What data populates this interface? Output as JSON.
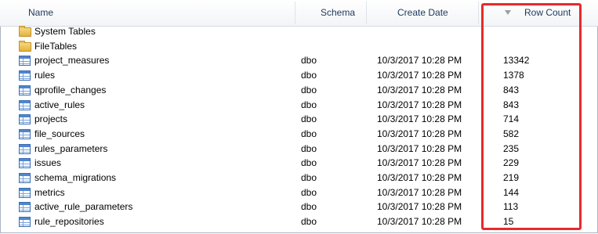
{
  "columns": {
    "name": "Name",
    "schema": "Schema",
    "create_date": "Create Date",
    "row_count": "Row Count"
  },
  "folders": [
    {
      "label": "System Tables"
    },
    {
      "label": "FileTables"
    }
  ],
  "tables": [
    {
      "name": "project_measures",
      "schema": "dbo",
      "create_date": "10/3/2017 10:28 PM",
      "row_count": "13342"
    },
    {
      "name": "rules",
      "schema": "dbo",
      "create_date": "10/3/2017 10:28 PM",
      "row_count": "1378"
    },
    {
      "name": "qprofile_changes",
      "schema": "dbo",
      "create_date": "10/3/2017 10:28 PM",
      "row_count": "843"
    },
    {
      "name": "active_rules",
      "schema": "dbo",
      "create_date": "10/3/2017 10:28 PM",
      "row_count": "843"
    },
    {
      "name": "projects",
      "schema": "dbo",
      "create_date": "10/3/2017 10:28 PM",
      "row_count": "714"
    },
    {
      "name": "file_sources",
      "schema": "dbo",
      "create_date": "10/3/2017 10:28 PM",
      "row_count": "582"
    },
    {
      "name": "rules_parameters",
      "schema": "dbo",
      "create_date": "10/3/2017 10:28 PM",
      "row_count": "235"
    },
    {
      "name": "issues",
      "schema": "dbo",
      "create_date": "10/3/2017 10:28 PM",
      "row_count": "229"
    },
    {
      "name": "schema_migrations",
      "schema": "dbo",
      "create_date": "10/3/2017 10:28 PM",
      "row_count": "219"
    },
    {
      "name": "metrics",
      "schema": "dbo",
      "create_date": "10/3/2017 10:28 PM",
      "row_count": "144"
    },
    {
      "name": "active_rule_parameters",
      "schema": "dbo",
      "create_date": "10/3/2017 10:28 PM",
      "row_count": "113"
    },
    {
      "name": "rule_repositories",
      "schema": "dbo",
      "create_date": "10/3/2017 10:28 PM",
      "row_count": "15"
    }
  ],
  "sort": {
    "column": "row_count",
    "direction": "descending",
    "icon": "sort-descending-icon"
  },
  "highlight_color": "#e8292b",
  "folder_icon": "folder-icon",
  "table_icon": "table-icon"
}
